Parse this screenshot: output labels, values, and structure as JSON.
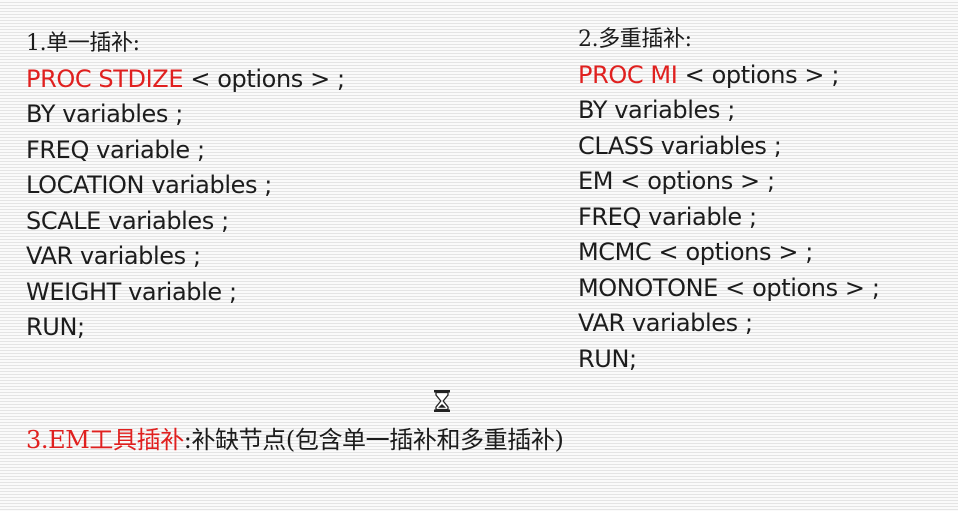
{
  "left": {
    "heading": "1.单一插补:",
    "proc_keyword": "PROC STDIZE",
    "proc_rest": " < options > ;",
    "lines": [
      "BY variables ;",
      "FREQ variable ;",
      "LOCATION variables ;",
      "SCALE variables ;",
      "VAR variables ;",
      "WEIGHT variable ;",
      "RUN;"
    ]
  },
  "right": {
    "heading": "2.多重插补:",
    "proc_keyword": "PROC MI",
    "proc_rest": " < options > ;",
    "lines": [
      "BY variables ;",
      "CLASS variables ;",
      "EM < options > ;",
      "FREQ variable ;",
      "MCMC < options > ;",
      "MONOTONE < options > ;",
      "VAR variables ;",
      "RUN;"
    ]
  },
  "bottom": {
    "red_text": "3.EM工具插补",
    "black_text": ":补缺节点(包含单一插补和多重插补)"
  },
  "icons": {
    "cursor": "hourglass-icon"
  },
  "colors": {
    "keyword": "#e0201f",
    "text": "#1c1c1c"
  }
}
